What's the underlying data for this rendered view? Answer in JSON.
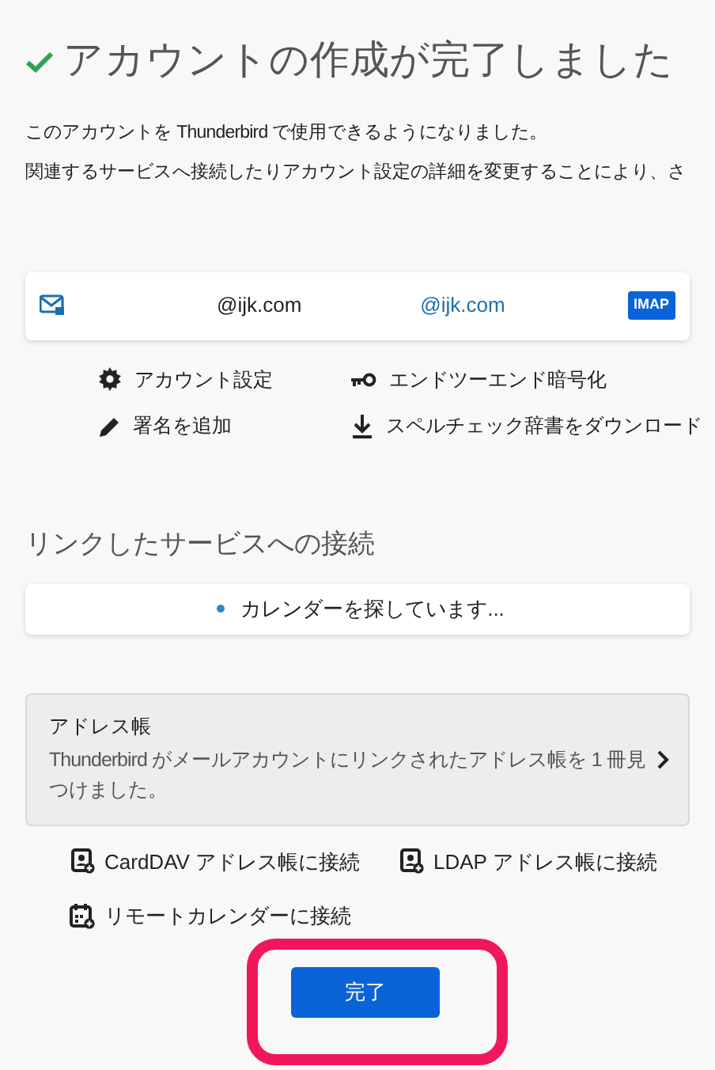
{
  "title": "アカウントの作成が完了しました",
  "intro": [
    "このアカウントを Thunderbird で使用できるようになりました。",
    "関連するサービスへ接続したりアカウント設定の詳細を変更することにより、さ"
  ],
  "account": {
    "addresses": [
      "@ijk.com",
      "@ijk.com"
    ],
    "protocol": "IMAP"
  },
  "actions": [
    {
      "kind": "gear",
      "label": "アカウント設定"
    },
    {
      "kind": "key",
      "label": "エンドツーエンド暗号化"
    },
    {
      "kind": "pencil",
      "label": "署名を追加"
    },
    {
      "kind": "download",
      "label": "スペルチェック辞書をダウンロード"
    }
  ],
  "linked_services": {
    "heading": "リンクしたサービスへの接続",
    "status": "カレンダーを探しています...",
    "address_book": {
      "title": "アドレス帳",
      "description": "Thunderbird がメールアカウントにリンクされたアドレス帳を 1 冊見つけました。"
    }
  },
  "connect_links": [
    {
      "kind": "addressbook",
      "label": "CardDAV アドレス帳に接続"
    },
    {
      "kind": "addressbook",
      "label": "LDAP アドレス帳に接続"
    },
    {
      "kind": "calendar",
      "label": "リモートカレンダーに接続"
    }
  ],
  "done_button": "完了"
}
